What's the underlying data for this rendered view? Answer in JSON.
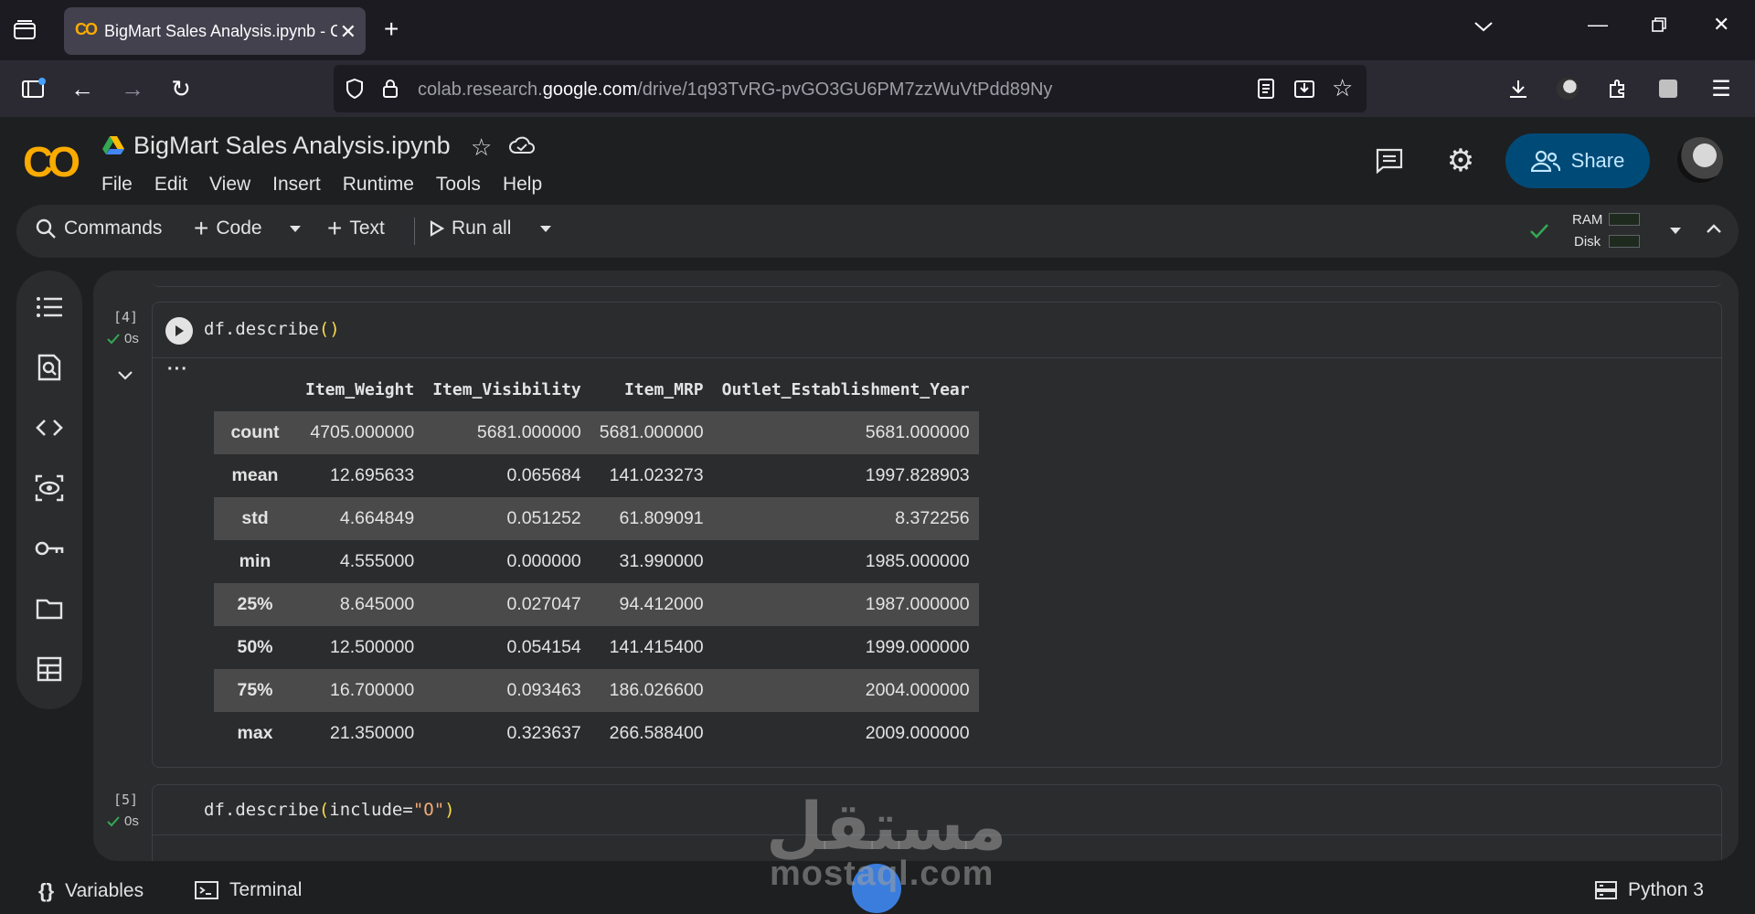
{
  "browser": {
    "tab_title": "BigMart Sales Analysis.ipynb - C",
    "url_prefix": "colab.research.",
    "url_domain": "google.com",
    "url_path": "/drive/1q93TvRG-pvGO3GU6PM7zzWuVtPdd89Ny"
  },
  "colab": {
    "logo": "CO",
    "notebook_title": "BigMart Sales Analysis.ipynb",
    "menu": [
      "File",
      "Edit",
      "View",
      "Insert",
      "Runtime",
      "Tools",
      "Help"
    ],
    "share_label": "Share"
  },
  "toolbar": {
    "commands": "Commands",
    "code": "Code",
    "text": "Text",
    "run_all": "Run all",
    "ram": "RAM",
    "disk": "Disk"
  },
  "cells": [
    {
      "exec_count": "[4]",
      "time": "0s",
      "code_fn": "df.describe",
      "code_open": "(",
      "code_close": ")",
      "output_table": {
        "columns": [
          "Item_Weight",
          "Item_Visibility",
          "Item_MRP",
          "Outlet_Establishment_Year"
        ],
        "rows": [
          {
            "index": "count",
            "values": [
              "4705.000000",
              "5681.000000",
              "5681.000000",
              "5681.000000"
            ]
          },
          {
            "index": "mean",
            "values": [
              "12.695633",
              "0.065684",
              "141.023273",
              "1997.828903"
            ]
          },
          {
            "index": "std",
            "values": [
              "4.664849",
              "0.051252",
              "61.809091",
              "8.372256"
            ]
          },
          {
            "index": "min",
            "values": [
              "4.555000",
              "0.000000",
              "31.990000",
              "1985.000000"
            ]
          },
          {
            "index": "25%",
            "values": [
              "8.645000",
              "0.027047",
              "94.412000",
              "1987.000000"
            ]
          },
          {
            "index": "50%",
            "values": [
              "12.500000",
              "0.054154",
              "141.415400",
              "1999.000000"
            ]
          },
          {
            "index": "75%",
            "values": [
              "16.700000",
              "0.093463",
              "186.026600",
              "2004.000000"
            ]
          },
          {
            "index": "max",
            "values": [
              "21.350000",
              "0.323637",
              "266.588400",
              "2009.000000"
            ]
          }
        ]
      }
    },
    {
      "exec_count": "[5]",
      "time": "0s",
      "code_fn": "df.describe",
      "code_open": "(",
      "code_arg": "include=",
      "code_str": "\"O\"",
      "code_close": ")"
    }
  ],
  "statusbar": {
    "variables": "Variables",
    "terminal": "Terminal",
    "kernel": "Python 3"
  },
  "watermark": {
    "arabic": "مستقل",
    "latin": "mostaql.com"
  },
  "colors": {
    "accent": "#f9ab00",
    "share_bg": "#004a77",
    "success": "#34a853"
  }
}
